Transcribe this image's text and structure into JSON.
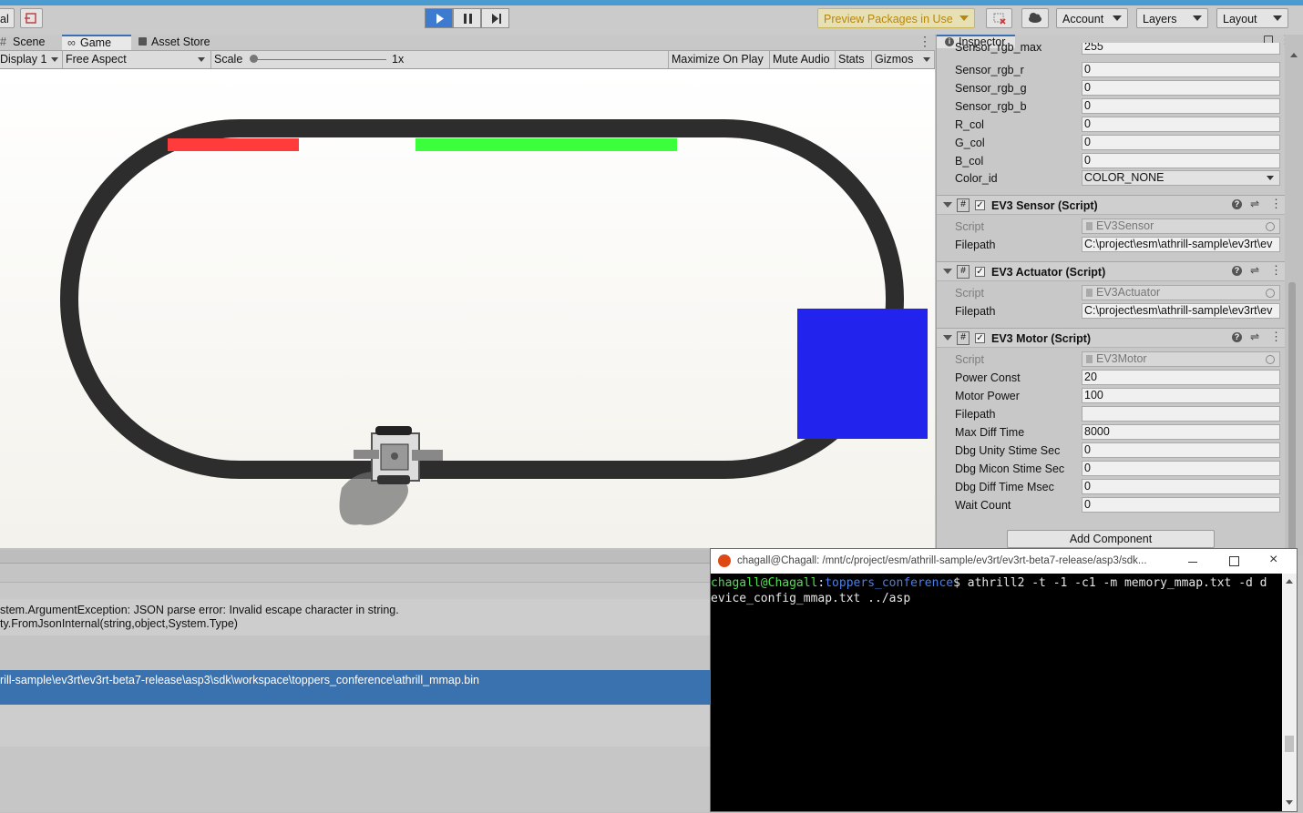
{
  "toolbar": {
    "left_partial": "al",
    "preview_packages": "Preview Packages in Use",
    "account": "Account",
    "layers": "Layers",
    "layout": "Layout"
  },
  "tabs": [
    {
      "label": "Scene"
    },
    {
      "label": "Game"
    },
    {
      "label": "Asset Store"
    }
  ],
  "game_bar": {
    "display": "Display 1",
    "aspect": "Free Aspect",
    "scale_label": "Scale",
    "scale_value": "1x",
    "maximize": "Maximize On Play",
    "mute": "Mute Audio",
    "stats": "Stats",
    "gizmos": "Gizmos"
  },
  "inspector": {
    "tab": "Inspector",
    "top_fields": [
      {
        "label": "Sensor_rgb_max",
        "value": "255"
      },
      {
        "label": "Sensor_rgb_r",
        "value": "0"
      },
      {
        "label": "Sensor_rgb_g",
        "value": "0"
      },
      {
        "label": "Sensor_rgb_b",
        "value": "0"
      },
      {
        "label": "R_col",
        "value": "0"
      },
      {
        "label": "G_col",
        "value": "0"
      },
      {
        "label": "B_col",
        "value": "0"
      },
      {
        "label": "Color_id",
        "value": "COLOR_NONE"
      }
    ],
    "sensor": {
      "title": "EV3 Sensor (Script)",
      "script_label": "Script",
      "script_value": "EV3Sensor",
      "filepath_label": "Filepath",
      "filepath_value": "C:\\project\\esm\\athrill-sample\\ev3rt\\ev"
    },
    "actuator": {
      "title": "EV3 Actuator (Script)",
      "script_label": "Script",
      "script_value": "EV3Actuator",
      "filepath_label": "Filepath",
      "filepath_value": "C:\\project\\esm\\athrill-sample\\ev3rt\\ev"
    },
    "motor": {
      "title": "EV3 Motor (Script)",
      "script_label": "Script",
      "script_value": "EV3Motor",
      "fields": [
        {
          "label": "Power Const",
          "value": "20"
        },
        {
          "label": "Motor Power",
          "value": "100"
        },
        {
          "label": "Filepath",
          "value": ""
        },
        {
          "label": "Max Diff Time",
          "value": "8000"
        },
        {
          "label": "Dbg Unity Stime Sec",
          "value": "0"
        },
        {
          "label": "Dbg Micon Stime Sec",
          "value": "0"
        },
        {
          "label": "Dbg Diff Time Msec",
          "value": "0"
        },
        {
          "label": "Wait Count",
          "value": "0"
        }
      ]
    },
    "add_component": "Add Component"
  },
  "console": {
    "line1": "stem.ArgumentException: JSON parse error: Invalid escape character in string.",
    "line2": "ty.FromJsonInternal(string,object,System.Type)",
    "line3": "rill-sample\\ev3rt\\ev3rt-beta7-release\\asp3\\sdk\\workspace\\toppers_conference\\athrill_mmap.bin"
  },
  "terminal": {
    "title": "chagall@Chagall: /mnt/c/project/esm/athrill-sample/ev3rt/ev3rt-beta7-release/asp3/sdk...",
    "prompt_user": "chagall@Chagall",
    "prompt_sep": ":",
    "prompt_dir": "toppers_conference",
    "prompt_end": "$",
    "command_1": " athrill2 -t -1 -c1 -m memory_mmap.txt -d d",
    "command_2": "evice_config_mmap.txt ../asp"
  },
  "colors": {
    "red_line": "#ff3b3b",
    "green_line": "#3cff3c",
    "blue_block": "#2323ee",
    "track": "#2d2d2d",
    "selected_row": "#3a72b0"
  }
}
